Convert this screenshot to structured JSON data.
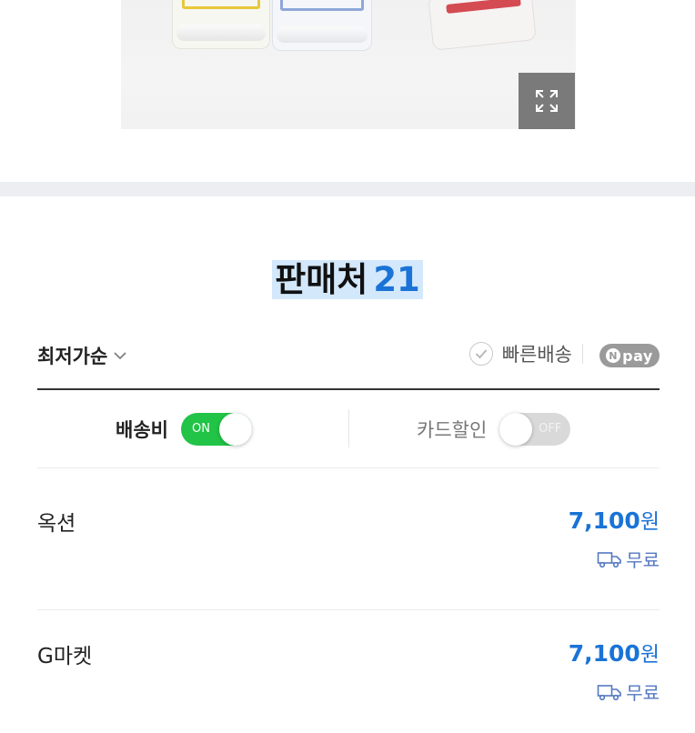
{
  "product_image": {
    "expand_icon": "expand-icon"
  },
  "sellers_section": {
    "title": "판매처",
    "count": "21"
  },
  "sort": {
    "label": "최저가순",
    "icon": "chevron-down-icon"
  },
  "filters": {
    "fast_delivery_label": "빠른배송",
    "npay_label": "pay",
    "npay_n": "N"
  },
  "toggles": [
    {
      "label": "배송비",
      "state": "ON",
      "on": true
    },
    {
      "label": "카드할인",
      "state": "OFF",
      "on": false
    }
  ],
  "sellers": [
    {
      "name": "옥션",
      "price": "7,100",
      "currency": "원",
      "shipping": "무료"
    },
    {
      "name": "G마켓",
      "price": "7,100",
      "currency": "원",
      "shipping": "무료"
    }
  ],
  "colors": {
    "accent_blue": "#1a73d6",
    "toggle_on": "#21c446",
    "shipping_blue": "#5578c2"
  }
}
